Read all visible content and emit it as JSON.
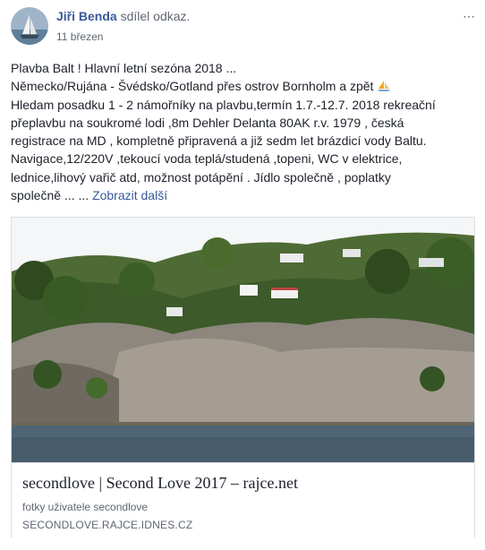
{
  "post": {
    "author": "Jiři Benda",
    "action": "sdílel odkaz.",
    "timestamp": "11 březen",
    "lines": [
      "Plavba Balt ! Hlavní letní sezóna 2018 ...",
      "Německo/Rujána - Švédsko/Gotland přes ostrov Bornholm a zpět",
      "Hledam posadku 1 - 2 námořníky na plavbu,termín 1.7.-12.7. 2018 rekreační",
      "přeplavbu na soukromé lodi ,8m Dehler Delanta 80AK r.v. 1979 , česká",
      "registrace na MD , kompletně připravená a již sedm let brázdicí vody Baltu.",
      "Navigace,12/220V ,tekoucí voda teplá/studená ,topeni, WC v elektrice,",
      "lednice,lihový vařič atd, možnost potápění . Jídlo společně , poplatky"
    ],
    "last_line": "společně ... ...",
    "see_more": "Zobrazit další",
    "more_icon": "⋯"
  },
  "link_card": {
    "title": "secondlove | Second Love 2017 – rajce.net",
    "description": "fotky uživatele secondlove",
    "domain": "SECONDLOVE.RAJCE.IDNES.CZ"
  }
}
